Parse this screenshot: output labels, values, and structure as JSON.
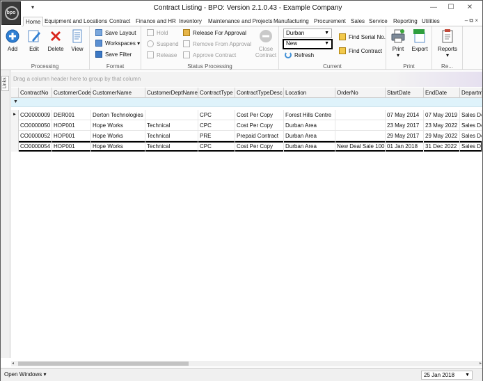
{
  "titlebar": {
    "title": "Contract Listing - BPO: Version 2.1.0.43 - Example Company",
    "logo_text": "bpo",
    "qat_icon": "chevron-down-icon",
    "min": "—",
    "max": "☐",
    "close": "✕"
  },
  "tabs": [
    "Home",
    "Equipment and Locations",
    "Contract",
    "Finance and HR",
    "Inventory",
    "Maintenance and Projects",
    "Manufacturing",
    "Procurement",
    "Sales",
    "Service",
    "Reporting",
    "Utilities"
  ],
  "tab_icons": "– ⧉ ×",
  "ribbon": {
    "processing": {
      "label": "Processing",
      "add": "Add",
      "edit": "Edit",
      "delete": "Delete",
      "view": "View"
    },
    "format": {
      "label": "Format",
      "save_layout": "Save Layout",
      "workspaces": "Workspaces",
      "save_filter": "Save Filter"
    },
    "status_processing": {
      "label": "Status Processing",
      "hold": "Hold",
      "suspend": "Suspend",
      "release": "Release",
      "release_for_approval": "Release For Approval",
      "remove_from_approval": "Remove From Approval",
      "approve_contract": "Approve Contract",
      "close_contract_1": "Close",
      "close_contract_2": "Contract"
    },
    "current": {
      "label": "Current",
      "location_value": "Durban",
      "status_value": "New",
      "refresh": "Refresh",
      "find_serial": "Find Serial No.",
      "find_contract": "Find Contract"
    },
    "print": {
      "label": "Print",
      "print": "Print",
      "export": "Export",
      "export_badge": "XLSX"
    },
    "reports": {
      "label": "Re...",
      "reports": "Reports"
    }
  },
  "links_label": "Links",
  "group_panel_hint": "Drag a column header here to group by that column",
  "grid": {
    "columns": [
      "ContractNo",
      "CustomerCode",
      "CustomerName",
      "CustomerDeptName",
      "ContractType",
      "ContractTypeDesc",
      "Location",
      "OrderNo",
      "StartDate",
      "EndDate",
      "Departm"
    ],
    "filter_icon": "▼",
    "current_row_marker": "►",
    "rows": [
      [
        "CO0000009",
        "DER001",
        "Derton Technologies",
        "",
        "CPC",
        "Cost Per Copy",
        "Forest Hills Centre",
        "",
        "07 May 2014",
        "07 May 2019",
        "Sales De"
      ],
      [
        "CO0000050",
        "HOP001",
        "Hope Works",
        "Technical",
        "CPC",
        "Cost Per Copy",
        "Durban Area",
        "",
        "23 May 2017",
        "23 May 2022",
        "Sales De"
      ],
      [
        "CO0000052",
        "HOP001",
        "Hope Works",
        "Technical",
        "PRE",
        "Prepaid Contract",
        "Durban Area",
        "",
        "29 May 2017",
        "29 May 2022",
        "Sales De"
      ],
      [
        "CO0000054",
        "HOP001",
        "Hope Works",
        "Technical",
        "CPC",
        "Cost Per Copy",
        "Durban Area",
        "New Deal Sale 100",
        "01 Jan 2018",
        "31 Dec 2022",
        "Sales De"
      ]
    ]
  },
  "statusbar": {
    "open_windows": "Open Windows",
    "date": "25 Jan 2018"
  },
  "colors": {
    "accent": "#1e6fc7",
    "delete": "#d9261c",
    "filter_row": "#dff3fb"
  }
}
